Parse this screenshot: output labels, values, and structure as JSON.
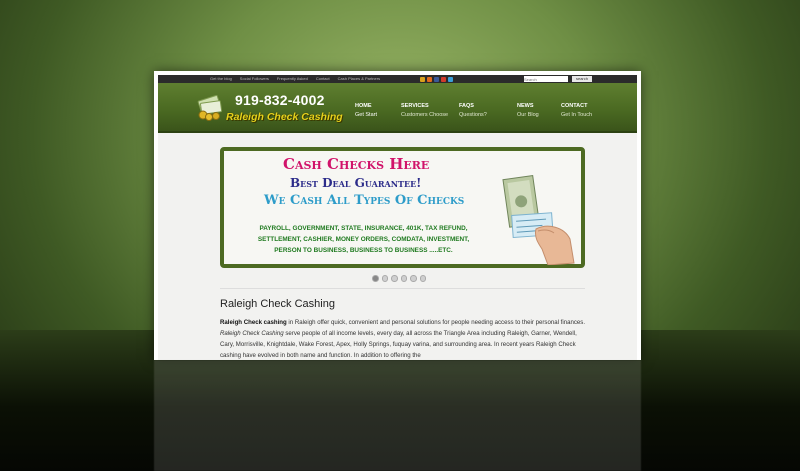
{
  "topbar": {
    "links": [
      "Get the blog",
      "Social Followers",
      "Frequently Asked",
      "Contact",
      "Cash Places & Partners"
    ],
    "search_placeholder": "Search",
    "search_button": "search",
    "social_colors": [
      "#d9a21c",
      "#e26a1c",
      "#3b5998",
      "#d23b2c",
      "#3aa0d9"
    ]
  },
  "header": {
    "phone": "919-832-4002",
    "brand": "Raleigh Check Cashing",
    "nav": [
      {
        "title": "HOME",
        "sub": "Get Start"
      },
      {
        "title": "SERVICES",
        "sub": "Customers Choose"
      },
      {
        "title": "FAQS",
        "sub": "Questions?"
      },
      {
        "title": "NEWS",
        "sub": "Our Blog"
      },
      {
        "title": "CONTACT",
        "sub": "Get In Touch"
      }
    ]
  },
  "banner": {
    "line1": "Cash Checks Here",
    "line2": "Best Deal Guarantee!",
    "line3": "We Cash All Types Of Checks",
    "lines": [
      "PAYROLL, GOVERNMENT, STATE, INSURANCE, 401K, TAX REFUND,",
      "SETTLEMENT, CASHIER, MONEY ORDERS, COMDATA, INVESTMENT,",
      "PERSON TO BUSINESS, BUSINESS TO BUSINESS .....ETC."
    ]
  },
  "slider": {
    "count": 6,
    "active_index": 0
  },
  "content": {
    "title": "Raleigh Check Cashing",
    "intro_bold": "Raleigh Check cashing",
    "intro_1": " in Raleigh offer quick, convenient and personal solutions for people needing access to their personal finances. ",
    "intro_italic": "Raleigh Check Cashing",
    "intro_2": " serve people of all income levels, every day, all across the Triangle Area including Raleigh, Garner, Wendell, Cary, Morrisville, Knightdale, Wake Forest, Apex, Holly Springs, fuquay varina, and surrounding area. In recent years Raleigh Check cashing have evolved in both name and function. In addition to offering the"
  },
  "colors": {
    "header_green": "#4b6a22",
    "brand_yellow": "#e6d21c",
    "cash_pink": "#d1136a",
    "deal_navy": "#2c2c8a",
    "types_blue": "#2d9cc9",
    "list_green": "#1f7a1f"
  }
}
